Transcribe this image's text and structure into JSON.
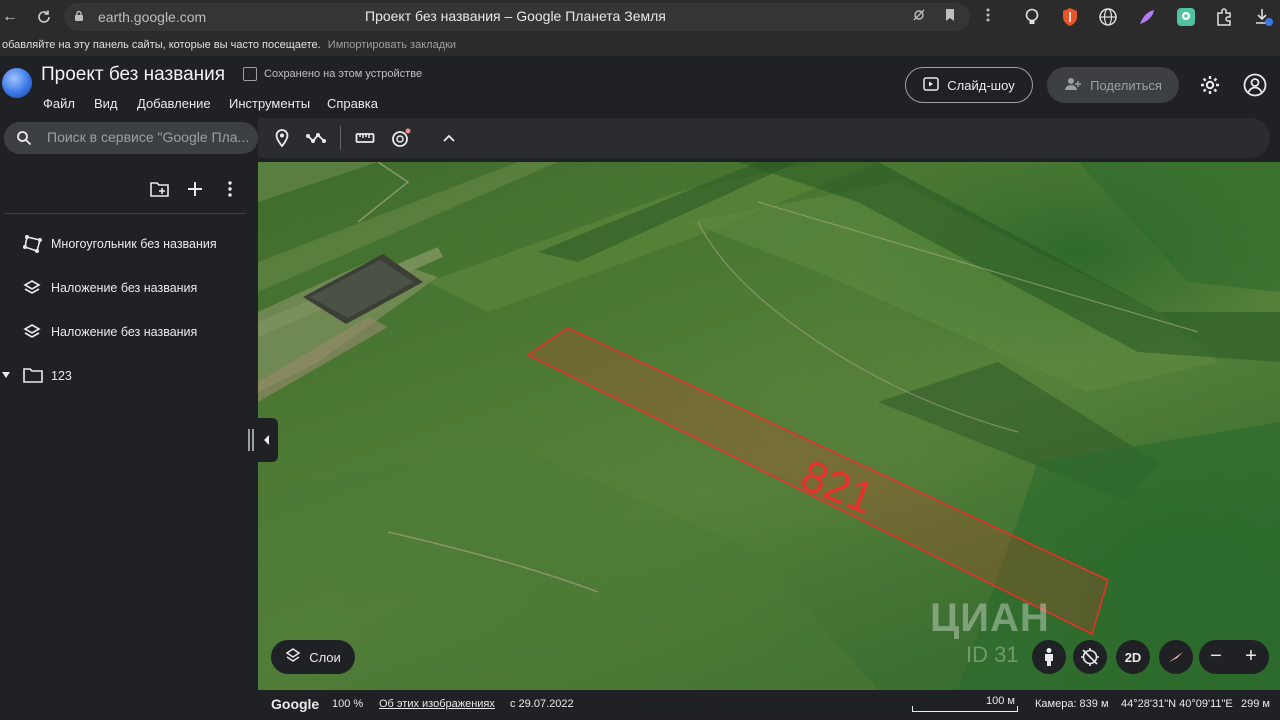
{
  "browser": {
    "url": "earth.google.com",
    "tab_title": "Проект без названия – Google Планета Земля",
    "bookmarks_hint": "обавляйте на эту панель сайты, которые вы часто посещаете.",
    "bookmarks_import": "Импортировать закладки"
  },
  "app": {
    "project_title": "Проект без названия",
    "saved_status": "Сохранено на этом устройстве",
    "menu": [
      "Файл",
      "Вид",
      "Добавление",
      "Инструменты",
      "Справка"
    ],
    "slideshow_label": "Слайд-шоу",
    "share_label": "Поделиться"
  },
  "search": {
    "placeholder": "Поиск в сервисе \"Google Пла..."
  },
  "sidebar": {
    "items": [
      {
        "label": "Многоугольник без названия",
        "icon": "polygon-icon"
      },
      {
        "label": "Наложение без названия",
        "icon": "overlay-icon"
      },
      {
        "label": "Наложение без названия",
        "icon": "overlay-icon"
      },
      {
        "label": "123",
        "icon": "folder-icon"
      }
    ]
  },
  "map": {
    "polygon_label": "821",
    "polygon_color": "#e8302a",
    "layers_label": "Слои",
    "view_mode": "2D",
    "watermark": "ЦИАН",
    "watermark_id": "ID 31"
  },
  "status": {
    "brand": "Google",
    "zoom": "100 %",
    "about_images": "Об этих изображениях",
    "date": "с 29.07.2022",
    "scale": "100 м",
    "camera": "Камера: 839 м",
    "coords": "44°28'31\"N 40°09'11\"E",
    "elevation": "299 м"
  }
}
